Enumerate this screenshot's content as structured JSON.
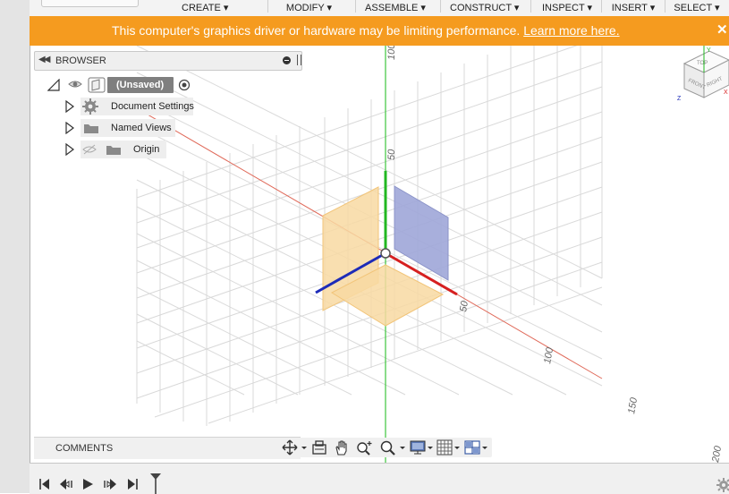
{
  "toolbar": {
    "menus": [
      {
        "label": "CREATE"
      },
      {
        "label": "MODIFY"
      },
      {
        "label": "ASSEMBLE"
      },
      {
        "label": "CONSTRUCT"
      },
      {
        "label": "INSPECT"
      },
      {
        "label": "INSERT"
      },
      {
        "label": "SELECT"
      }
    ]
  },
  "warning": {
    "message": "This computer's graphics driver or hardware may be limiting performance.",
    "link": "Learn more here.",
    "close": "✕",
    "background": "#f59b1f"
  },
  "browser": {
    "title": "BROWSER",
    "root": {
      "label": "(Unsaved)"
    },
    "items": [
      {
        "label": "Document Settings",
        "icon": "gear-icon"
      },
      {
        "label": "Named Views",
        "icon": "folder-icon"
      },
      {
        "label": "Origin",
        "icon": "folder-icon",
        "visibility": "hidden"
      }
    ]
  },
  "viewport": {
    "vertical_ticks": [
      "100",
      "50"
    ],
    "diagonal_ticks": [
      "50",
      "100",
      "150",
      "200"
    ],
    "axis_colors": {
      "x": "#d62020",
      "y": "#22b822",
      "z": "#1d2bb8"
    },
    "viewcube": {
      "faces": [
        "TOP",
        "FRONT",
        "RIGHT"
      ],
      "axis_labels": [
        "Y",
        "Z",
        "X"
      ]
    }
  },
  "comments": {
    "label": "COMMENTS"
  },
  "navigation_tools": [
    "orbit-icon",
    "look-at-icon",
    "pan-icon",
    "zoom-icon",
    "fit-icon",
    "display-settings-icon",
    "grid-settings-icon",
    "viewports-icon"
  ],
  "timeline": {
    "controls": [
      "first",
      "previous",
      "play",
      "next",
      "last"
    ]
  }
}
